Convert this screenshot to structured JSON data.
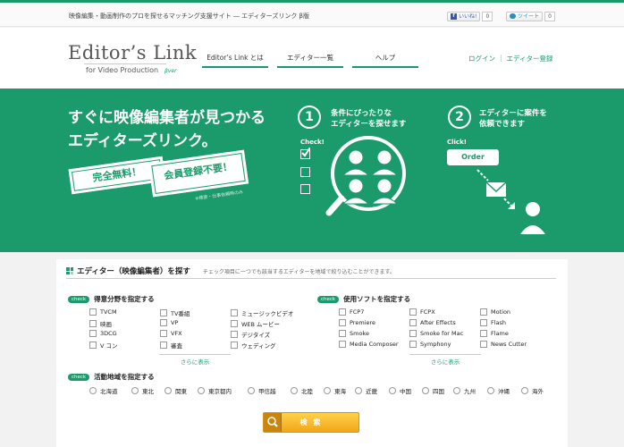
{
  "topbar": {
    "tagline": "映像編集・動画制作のプロを探せるマッチング支援サイト ― エディターズリンク β版",
    "like_label": "いいね!",
    "like_count": "0",
    "tweet_label": "ツイート",
    "tweet_count": "0"
  },
  "logo": {
    "main": "Editor’s Link",
    "sub": "for Video Production",
    "ver": "βver"
  },
  "nav": {
    "items": [
      "Editor’s Link とは",
      "エディター一覧",
      "ヘルプ"
    ],
    "login": "ログイン",
    "register": "エディター登録"
  },
  "hero": {
    "headline_1": "すぐに映像編集者が見つかる",
    "headline_2": "エディターズリンク。",
    "badge_free": "完全無料！",
    "badge_noreg": "会員登録不要！",
    "badge_fine": "※",
    "badge_note": "※検索・仕事依頼時のみ",
    "step1_num": "1",
    "step1_text_1": "条件にぴったりな",
    "step1_text_2": "エディターを探せます",
    "step1_check": "Check!",
    "step2_num": "2",
    "step2_text_1": "エディターに案件を",
    "step2_text_2": "依頼できます",
    "step2_click": "Click!",
    "order_label": "Order"
  },
  "search": {
    "title": "エディター（映像編集者）を探す",
    "desc": "チェック項目に一つでも該当するエディターを地域で絞り込むことができます。",
    "check_label": "check",
    "field_title": "得意分野を指定する",
    "field_options": [
      "TVCM",
      "TV番組",
      "ミュージックビデオ",
      "映画",
      "VP",
      "WEB ムービー",
      "3DCG",
      "VFX",
      "デジタイズ",
      "V コン",
      "審査",
      "ウェディング"
    ],
    "software_title": "使用ソフトを指定する",
    "software_options": [
      "FCP7",
      "FCPX",
      "Motion",
      "Premiere",
      "After Effects",
      "Flash",
      "Smoke",
      "Smoke for Mac",
      "Flame",
      "Media Composer",
      "Symphony",
      "News Cutter"
    ],
    "more_label": "さらに表示",
    "region_title": "活動地域を指定する",
    "regions": [
      "北海道",
      "東北",
      "関東",
      "東京都内",
      "甲信越",
      "北陸",
      "東海",
      "近畿",
      "中国",
      "四国",
      "九州",
      "沖縄",
      "海外"
    ],
    "search_button": "検 索"
  }
}
